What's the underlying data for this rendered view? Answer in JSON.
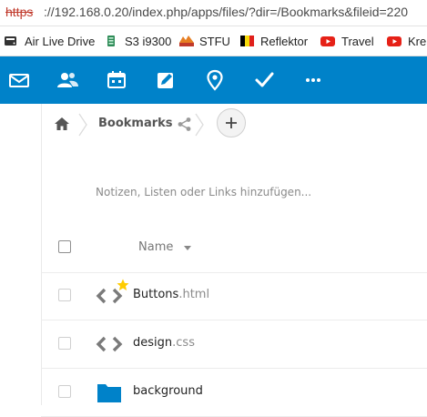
{
  "browser": {
    "url_scheme": "https",
    "url_rest": "://192.168.0.20/index.php/apps/files/?dir=/Bookmarks&fileid=220"
  },
  "bookmarks": [
    {
      "label": "Air Live Drive",
      "icon": "drive-icon"
    },
    {
      "label": "S3 i9300",
      "icon": "android-icon"
    },
    {
      "label": "STFU",
      "icon": "stfu-icon"
    },
    {
      "label": "Reflektor",
      "icon": "belgian-flag-icon"
    },
    {
      "label": "Travel",
      "icon": "youtube-icon"
    },
    {
      "label": "Kreh",
      "icon": "youtube-icon"
    }
  ],
  "app_nav": [
    "mail-icon",
    "contacts-icon",
    "calendar-icon",
    "notes-icon",
    "maps-icon",
    "tasks-icon",
    "more-icon"
  ],
  "breadcrumb": {
    "current": "Bookmarks",
    "add_label": "+"
  },
  "notes_placeholder": "Notizen, Listen oder Links hinzufügen...",
  "table": {
    "name_header": "Name",
    "rows": [
      {
        "base": "Buttons",
        "ext": ".html",
        "type": "code",
        "favorite": true
      },
      {
        "base": "design",
        "ext": ".css",
        "type": "code",
        "favorite": false
      },
      {
        "base": "background",
        "ext": "",
        "type": "folder",
        "favorite": false
      }
    ]
  },
  "colors": {
    "header_blue": "#0082c9",
    "folder_blue": "#0082c9",
    "star_yellow": "#fc0",
    "insecure_red": "#c0392b"
  }
}
